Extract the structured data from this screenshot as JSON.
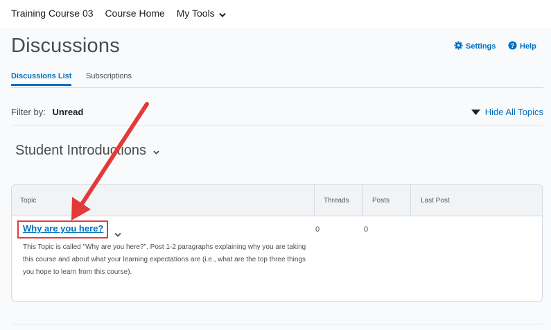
{
  "nav": {
    "course_name": "Training Course 03",
    "course_home": "Course Home",
    "my_tools": "My Tools"
  },
  "page": {
    "title": "Discussions",
    "settings_label": "Settings",
    "help_label": "Help"
  },
  "tabs": [
    {
      "label": "Discussions List",
      "active": true
    },
    {
      "label": "Subscriptions",
      "active": false
    }
  ],
  "filter": {
    "label": "Filter by:",
    "value": "Unread",
    "hide_all_topics": "Hide All Topics"
  },
  "category": {
    "title": "Student Introductions"
  },
  "table": {
    "columns": [
      "Topic",
      "Threads",
      "Posts",
      "Last Post"
    ],
    "rows": [
      {
        "topic_title": "Why are you here?",
        "threads": "0",
        "posts": "0",
        "last_post": "",
        "description": "This Topic is called \"Why are you here?\".  Post 1-2 paragraphs explaining why you are taking this course and about what your learning expectations are (i.e., what are the top three things you hope to learn from this course)."
      }
    ]
  },
  "colors": {
    "link": "#006fbf",
    "annotation_red": "#e23a3a",
    "text": "#494c4e"
  },
  "icons": [
    "chevron-down-icon",
    "gear-icon",
    "help-circle-icon",
    "triangle-down-icon",
    "annotation-arrow"
  ]
}
